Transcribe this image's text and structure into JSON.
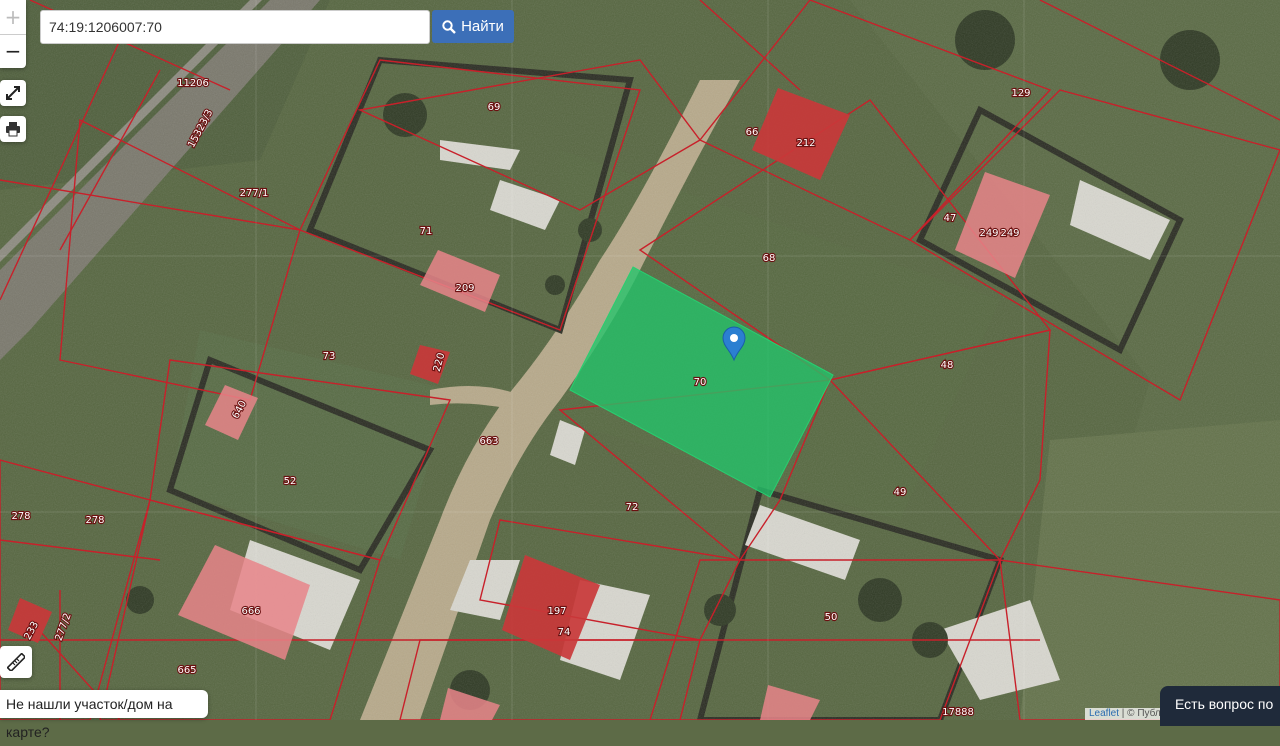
{
  "search": {
    "value": "74:19:1206007:70",
    "button_label": "Найти"
  },
  "controls": {
    "zoom_in": "+",
    "zoom_out": "−"
  },
  "notfound_label": "Не нашли участок/дом на карте?",
  "chat_label": "Есть вопрос по",
  "attribution": {
    "leaflet": "Leaflet",
    "rest": " | © Публ"
  },
  "colors": {
    "selected_parcel": "#22c46a",
    "building": "#d2554f",
    "parcel_border": "#c8202a"
  },
  "labels": [
    "11206",
    "15323/3",
    "277/1",
    "69",
    "71",
    "209",
    "73",
    "220",
    "640",
    "52",
    "278",
    "278",
    "233",
    "277/2",
    "666",
    "665",
    "663",
    "72",
    "70",
    "68",
    "212",
    "66",
    "129",
    "47",
    "249",
    "249",
    "48",
    "49",
    "197",
    "74",
    "50",
    "17888"
  ]
}
